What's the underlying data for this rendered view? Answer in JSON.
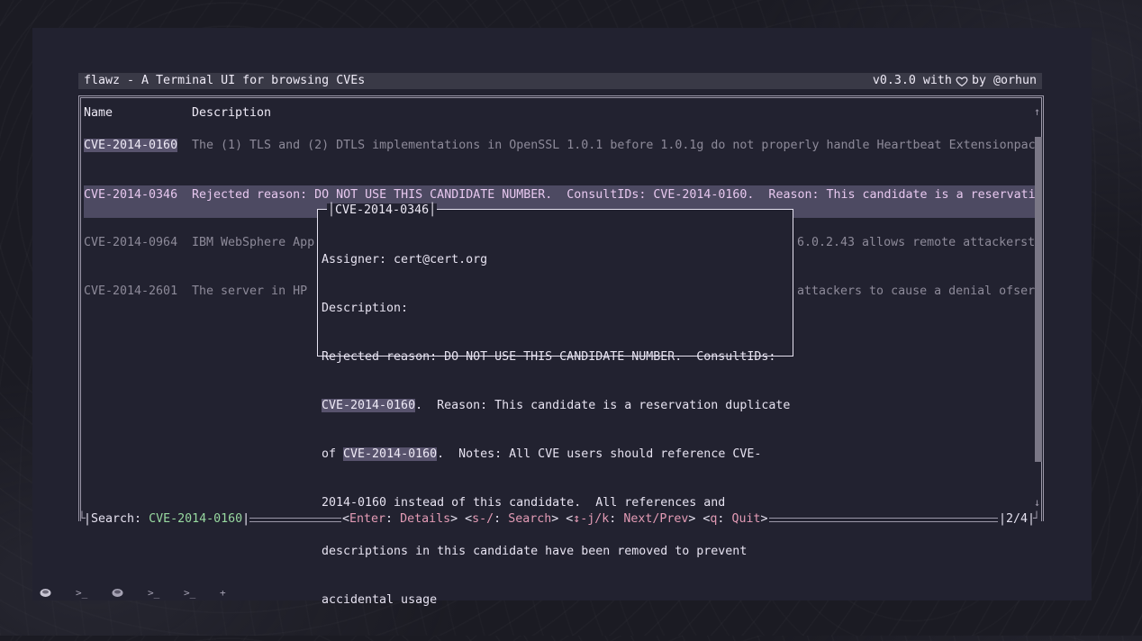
{
  "app": {
    "title": "flawz - A Terminal UI for browsing CVEs",
    "version_prefix": "v0.3.0 with",
    "version_suffix": "by @orhun"
  },
  "table": {
    "headers": [
      "Name",
      "Description"
    ],
    "rows": [
      {
        "name": "CVE-2014-0160",
        "description": "The (1) TLS and (2) DTLS implementations in OpenSSL 1.0.1 before 1.0.1g do not properly handle Heartbeat Extensionpac"
      },
      {
        "name": "CVE-2014-0346",
        "description": "Rejected reason: DO NOT USE THIS CANDIDATE NUMBER.  ConsultIDs: CVE-2014-0160.  Reason: This candidate is a reservati"
      },
      {
        "name": "CVE-2014-0964",
        "description_left": "IBM WebSphere App",
        "description_right": "6.0.2.43 allows remote attackerst"
      },
      {
        "name": "CVE-2014-2601",
        "description_left": "The server in HP",
        "description_right": "attackers to cause a denial ofser"
      }
    ]
  },
  "popup": {
    "title": "CVE-2014-0346",
    "assigner": "Assigner: cert@cert.org",
    "description_label": "Description:",
    "line1": "Rejected reason: DO NOT USE THIS CANDIDATE NUMBER.  ConsultIDs:",
    "line2_hl": "CVE-2014-0160",
    "line2_rest": ".  Reason: This candidate is a reservation duplicate",
    "line3_pre": "of ",
    "line3_hl": "CVE-2014-0160",
    "line3_rest": ".  Notes: All CVE users should reference CVE-",
    "line4": "2014-0160 instead of this candidate.  All references and",
    "line5": "descriptions in this candidate have been removed to prevent",
    "line6": "accidental usage"
  },
  "footer": {
    "search_label": "Search: ",
    "search_value": "CVE-2014-0160",
    "hint_enter_key": "Enter",
    "hint_enter_action": "Details",
    "hint_search_key": "s-/",
    "hint_search_action": "Search",
    "hint_nav_key": "↕-j/k",
    "hint_nav_action": "Next/Prev",
    "hint_quit_key": "q",
    "hint_quit_action": "Quit",
    "page": "2/4"
  },
  "taskbar": {
    "items": [
      "disk-icon",
      "terminal-icon",
      "disk-icon",
      "terminal-icon",
      "terminal-icon",
      "plus-icon"
    ],
    "plus_label": "+"
  },
  "colors": {
    "background": "#1b1b23",
    "window": "#222230",
    "selected_row": "#4d4a62",
    "highlight": "#58536d",
    "accent_pink": "#e39bb5",
    "accent_green": "#98d9a0"
  }
}
